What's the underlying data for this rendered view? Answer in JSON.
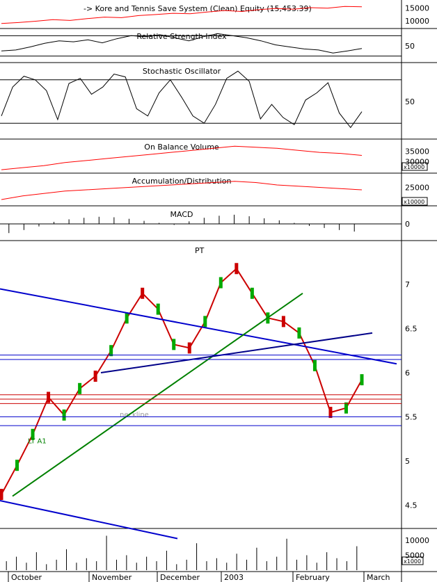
{
  "chart_data": [
    {
      "type": "line",
      "title": "-> Kore and Tennis Save System (Clean) Equity (15,453.39)",
      "yticks": [
        15000,
        10000
      ],
      "ylim": [
        7500,
        17000
      ],
      "series": [
        {
          "values": [
            8900,
            9300,
            9800,
            10400,
            10100,
            10800,
            11400,
            11200,
            12000,
            12400,
            12900,
            12700,
            13400,
            14000,
            13600,
            14300,
            14800,
            14500,
            15100,
            14900,
            15600,
            15453
          ]
        }
      ]
    },
    {
      "type": "line",
      "title": "Relative Strength Index",
      "yticks": [
        50
      ],
      "ylim": [
        20,
        80
      ],
      "series": [
        {
          "values": [
            40,
            42,
            48,
            55,
            60,
            58,
            62,
            56,
            64,
            70,
            68,
            72,
            66,
            60,
            68,
            74,
            70,
            66,
            60,
            52,
            48,
            44,
            42,
            36,
            40,
            45
          ]
        }
      ]
    },
    {
      "type": "line",
      "title": "Stochastic Oscillator",
      "yticks": [
        50
      ],
      "ylim": [
        0,
        100
      ],
      "series": [
        {
          "values": [
            30,
            70,
            85,
            80,
            65,
            25,
            75,
            82,
            60,
            70,
            88,
            84,
            40,
            30,
            62,
            80,
            56,
            30,
            20,
            46,
            82,
            92,
            78,
            26,
            46,
            28,
            18,
            52,
            62,
            76,
            34,
            14,
            36
          ]
        }
      ]
    },
    {
      "type": "line",
      "title": "On Balance Volume",
      "yticks": [
        35000,
        30000
      ],
      "y_multiplier": "x10000",
      "ylim": [
        25000,
        40000
      ],
      "series": [
        {
          "values": [
            26000,
            27000,
            28000,
            29500,
            30500,
            31500,
            32500,
            33500,
            34500,
            35500,
            36500,
            37500,
            37000,
            36500,
            35500,
            34500,
            34000,
            33000
          ]
        }
      ]
    },
    {
      "type": "line",
      "title": "Accumulation/Distribution",
      "yticks": [
        25000
      ],
      "y_multiplier": "x10000",
      "ylim": [
        18000,
        30000
      ],
      "series": [
        {
          "values": [
            20000,
            21500,
            22500,
            23500,
            24000,
            24500,
            25000,
            25500,
            26000,
            26500,
            27000,
            27500,
            27000,
            26000,
            25500,
            25000,
            24500,
            24000
          ]
        }
      ]
    },
    {
      "type": "bar",
      "title": "MACD",
      "yticks": [
        0
      ],
      "ylim": [
        -0.3,
        0.3
      ],
      "values": [
        -0.18,
        -0.12,
        -0.05,
        0.04,
        0.09,
        0.12,
        0.14,
        0.13,
        0.1,
        0.06,
        0.02,
        -0.02,
        0.05,
        0.12,
        0.16,
        0.18,
        0.15,
        0.11,
        0.07,
        0.02,
        -0.04,
        -0.08,
        -0.12,
        -0.15
      ]
    },
    {
      "type": "line",
      "title": "PT",
      "yticks": [
        7.0,
        6.5,
        6.0,
        5.5,
        5.0,
        4.5
      ],
      "ylim": [
        4.25,
        7.45
      ],
      "annotations": [
        "neckline",
        "LT A1"
      ],
      "series": [
        {
          "values": [
            4.62,
            4.95,
            5.3,
            5.72,
            5.52,
            5.82,
            5.96,
            6.25,
            6.62,
            6.9,
            6.72,
            6.32,
            6.28,
            6.58,
            7.02,
            7.18,
            6.9,
            6.62,
            6.58,
            6.45,
            6.08,
            5.55,
            5.6,
            5.92
          ]
        }
      ]
    },
    {
      "type": "bar",
      "title": "",
      "yticks": [
        10000,
        5000
      ],
      "y_multiplier": "x1000",
      "ylim": [
        0,
        13000
      ],
      "categories": [
        "October",
        "November",
        "December",
        "2003",
        "February",
        "March"
      ],
      "values": [
        3000,
        4500,
        2500,
        6000,
        2000,
        3500,
        7000,
        2500,
        4000,
        3000,
        11500,
        3500,
        5000,
        2500,
        4500,
        3000,
        6500,
        2000,
        3500,
        9000,
        3000,
        4000,
        2500,
        5500,
        3500,
        7500,
        3000,
        4500,
        10500,
        3500,
        5000,
        2500,
        6000,
        4000,
        3000,
        8000
      ]
    }
  ]
}
